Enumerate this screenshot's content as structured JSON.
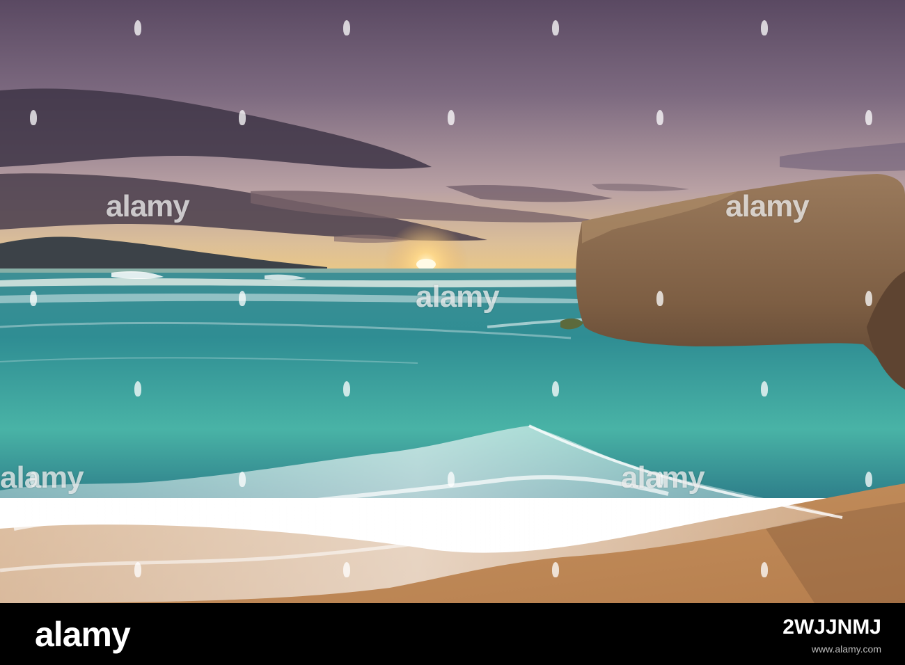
{
  "watermark": {
    "logo_text": "alamy",
    "image_id": "2WJJNMJ",
    "credit_line": "www.alamy.com"
  },
  "colors": {
    "sky_top": "#5e4c63",
    "sky_horizon": "#e6c48f",
    "sea": "#3aa6a0",
    "foam": "#f1ece5",
    "sand": "#c98e5a",
    "rock": "#8c6b4e",
    "banner": "#000000"
  }
}
